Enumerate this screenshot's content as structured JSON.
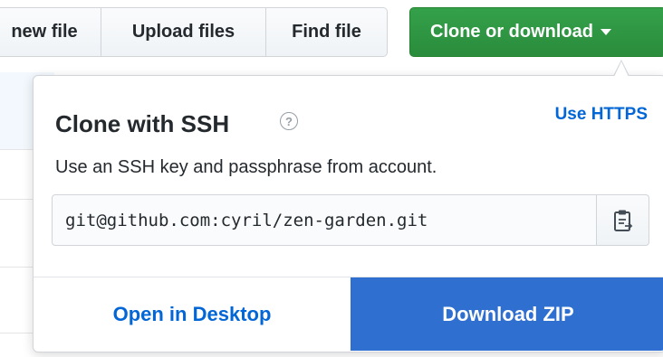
{
  "toolbar": {
    "buttons": [
      "new file",
      "Upload files",
      "Find file"
    ],
    "clone_label": "Clone or download"
  },
  "dropdown": {
    "title": "Clone with SSH",
    "help_icon": "question-circle-icon",
    "use_https_label": "Use HTTPS",
    "description": "Use an SSH key and passphrase from account.",
    "clone_url": "git@github.com:cyril/zen-garden.git",
    "copy_icon": "clipboard-icon",
    "open_desktop_label": "Open in Desktop",
    "download_zip_label": "Download ZIP"
  },
  "colors": {
    "clone_green": "#2c9a42",
    "download_blue": "#2f6fd0",
    "link_blue": "#0366d6"
  }
}
